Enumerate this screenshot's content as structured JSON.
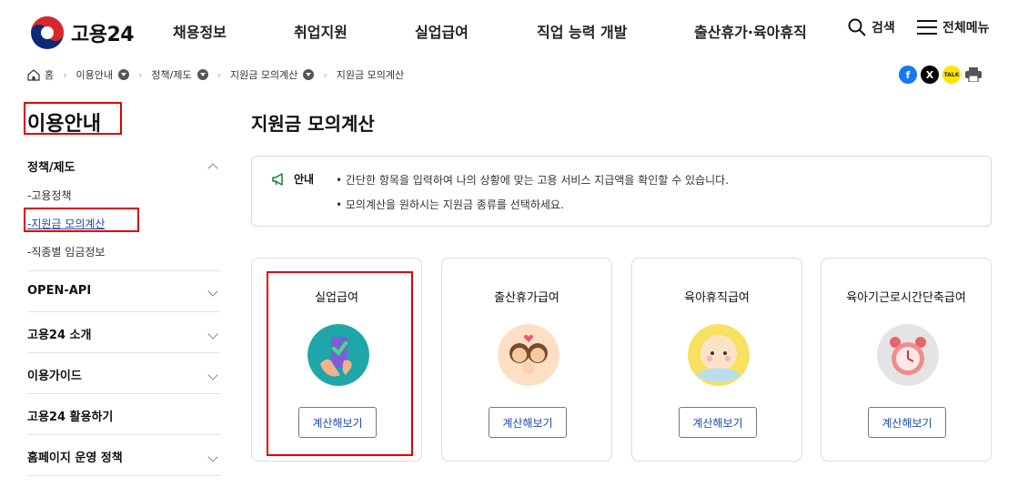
{
  "header": {
    "logo_text": "고용24",
    "nav": [
      "채용정보",
      "취업지원",
      "실업급여",
      "직업 능력 개발",
      "출산휴가·육아휴직"
    ],
    "search_label": "검색",
    "menu_label": "전체메뉴"
  },
  "breadcrumb": {
    "home": "홈",
    "items": [
      "이용안내",
      "정책/제도",
      "지원금 모의계산",
      "지원금 모의계산"
    ]
  },
  "share": {
    "facebook": "f",
    "x": "X",
    "kakao": "TALK",
    "colors": {
      "facebook": "#1877f2",
      "x": "#000000",
      "kakao": "#fee500"
    }
  },
  "sidebar": {
    "title": "이용안내",
    "section": "정책/제도",
    "subitems": [
      "고용정책",
      "지원금 모의계산",
      "직종별 임금정보"
    ],
    "items": [
      "OPEN-API",
      "고용24 소개",
      "이용가이드",
      "고용24 활용하기",
      "홈페이지 운영 정책"
    ]
  },
  "main": {
    "title": "지원금 모의계산",
    "notice": {
      "label": "안내",
      "lines": [
        "• 간단한 항목을 입력하여 나의 상황에 맞는 고용 서비스 지급액을 확인할 수 있습니다.",
        "• 모의계산을 원하시는 지원금 종류를 선택하세요."
      ]
    },
    "cards": [
      {
        "title": "실업급여",
        "button": "계산해보기",
        "icon": "hand-phone-check-icon"
      },
      {
        "title": "출산휴가급여",
        "button": "계산해보기",
        "icon": "parents-baby-icon"
      },
      {
        "title": "육아휴직급여",
        "button": "계산해보기",
        "icon": "baby-face-icon"
      },
      {
        "title": "육아기근로시간단축급여",
        "button": "계산해보기",
        "icon": "alarm-clock-icon"
      }
    ]
  },
  "colors": {
    "accent": "#1b49b8",
    "highlight": "#e00000",
    "notice_icon": "#1e7a3d"
  }
}
